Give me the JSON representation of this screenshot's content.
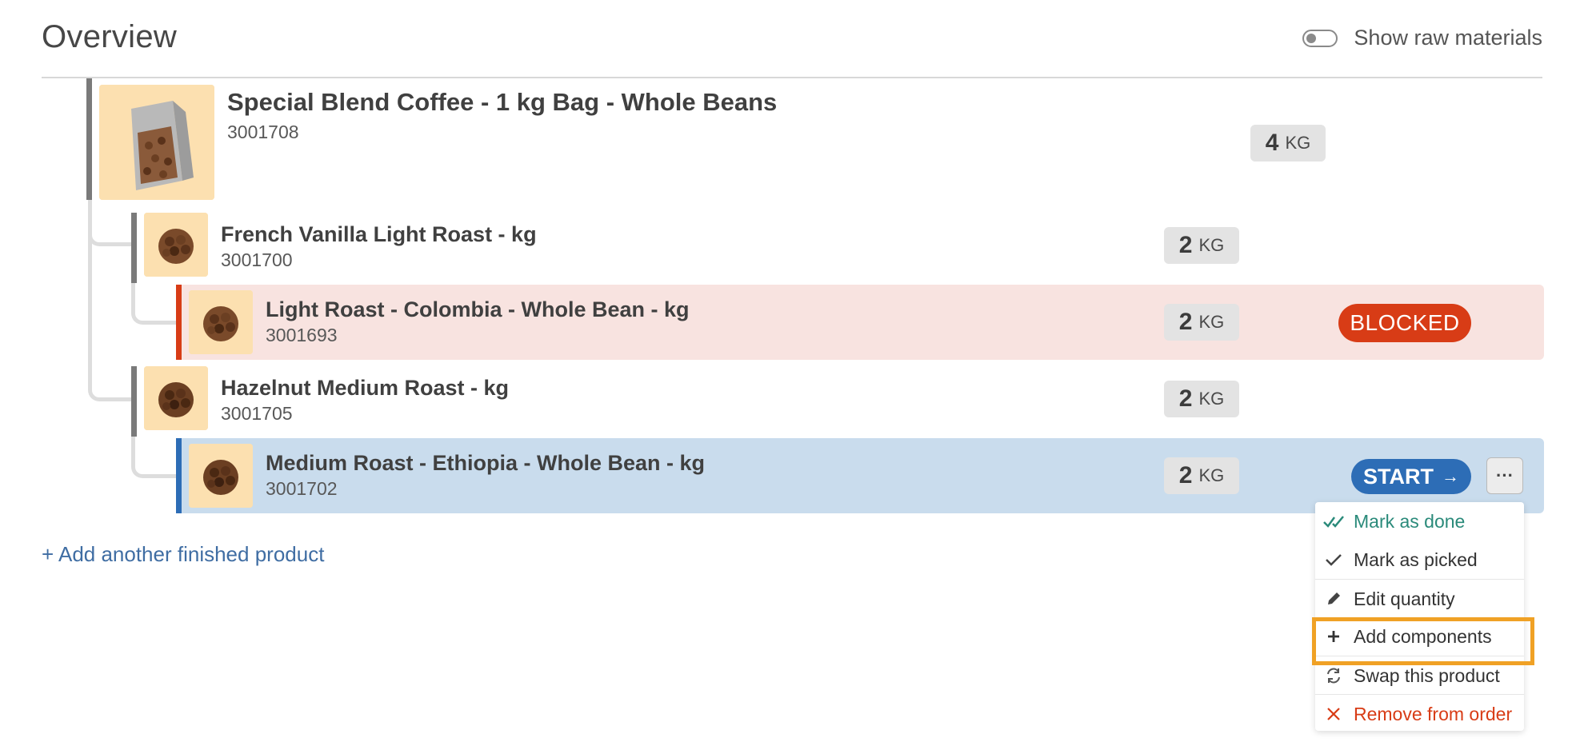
{
  "header": {
    "title": "Overview",
    "toggle_label": "Show raw materials",
    "toggle_on": false
  },
  "rows": [
    {
      "name": "Special Blend Coffee - 1 kg Bag - Whole Beans",
      "sku": "3001708",
      "qty": "4",
      "unit": "KG"
    },
    {
      "name": "French Vanilla Light Roast - kg",
      "sku": "3001700",
      "qty": "2",
      "unit": "KG"
    },
    {
      "name": "Light Roast - Colombia - Whole Bean - kg",
      "sku": "3001693",
      "qty": "2",
      "unit": "KG",
      "status": "BLOCKED"
    },
    {
      "name": "Hazelnut Medium Roast - kg",
      "sku": "3001705",
      "qty": "2",
      "unit": "KG"
    },
    {
      "name": "Medium Roast - Ethiopia - Whole Bean - kg",
      "sku": "3001702",
      "qty": "2",
      "unit": "KG",
      "action": "START",
      "action_icon": "arrow-right-icon",
      "more_label": "···"
    }
  ],
  "add_product_label": "+ Add another finished product",
  "menu": {
    "items": [
      {
        "label": "Mark as done",
        "icon": "double-check-icon",
        "color": "#2a8a7a"
      },
      {
        "label": "Mark as picked",
        "icon": "check-icon",
        "color": "#333333"
      },
      {
        "label": "Edit quantity",
        "icon": "pencil-icon",
        "color": "#333333"
      },
      {
        "label": "Add components",
        "icon": "plus-icon",
        "color": "#333333",
        "highlighted": true
      },
      {
        "label": "Swap this product",
        "icon": "swap-icon",
        "color": "#333333"
      },
      {
        "label": "Remove from order",
        "icon": "x-icon",
        "color": "#d83c16"
      }
    ]
  },
  "colors": {
    "blocked_row_bg": "#f8e3e0",
    "blocked_bar": "#d83c16",
    "active_row_bg": "#c9dced",
    "active_bar": "#2d6db6",
    "parent_bar": "#7a7a7a",
    "highlight": "#f0a125"
  }
}
